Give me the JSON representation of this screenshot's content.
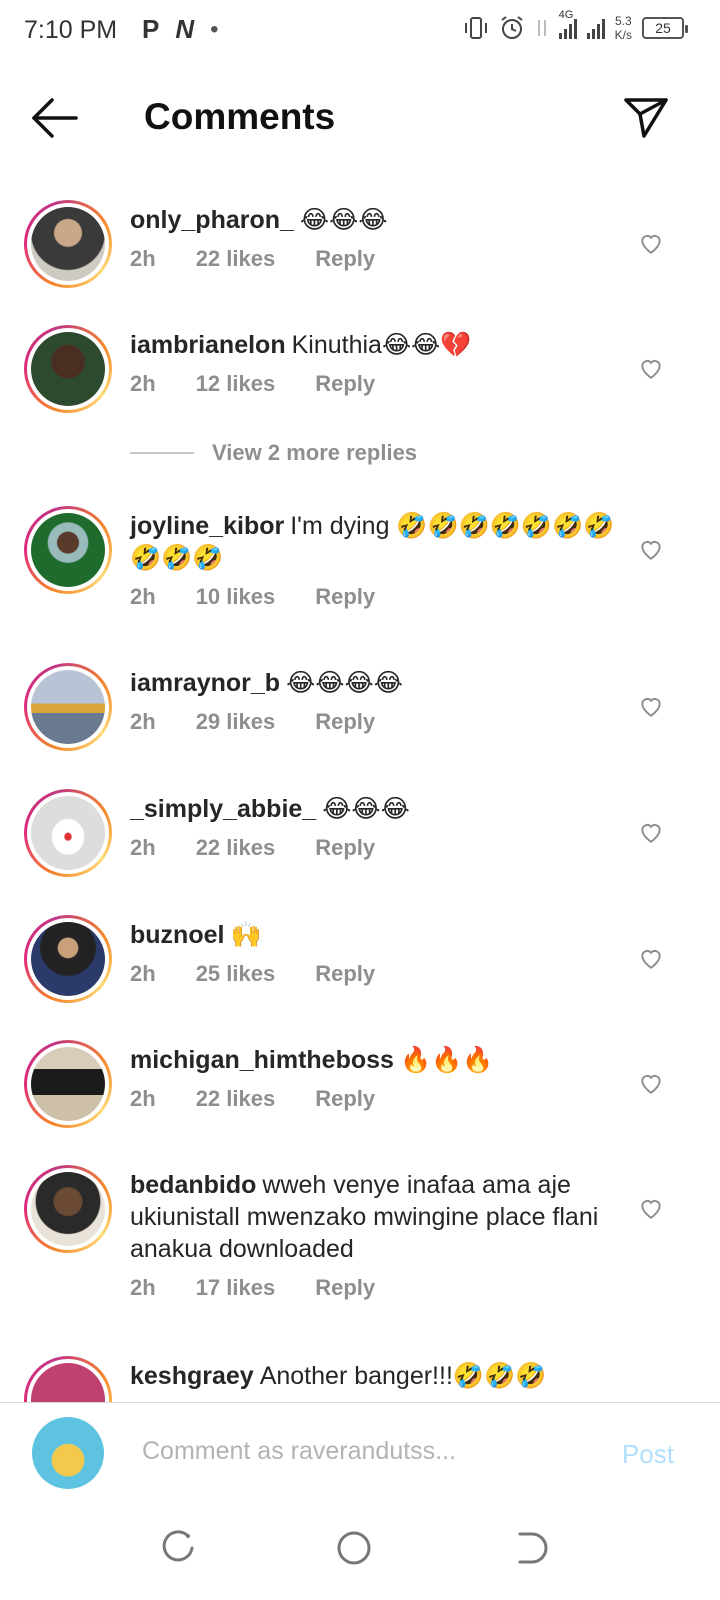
{
  "status_bar": {
    "time": "7:10 PM",
    "left_icons": [
      "P",
      "N",
      "•"
    ],
    "network": "4G",
    "speed_value": "5.3",
    "speed_unit": "K/s",
    "battery": "25"
  },
  "header": {
    "title": "Comments",
    "back_icon": "arrow-left-icon",
    "share_icon": "paper-plane-icon"
  },
  "comments": [
    {
      "username": "only_pharon_",
      "text": "😂😂😂",
      "time": "2h",
      "likes": "22 likes",
      "reply": "Reply",
      "avatar_color": "#8a7a6a"
    },
    {
      "username": "iambrianelon",
      "text": "Kinuthia😂😂💔",
      "time": "2h",
      "likes": "12 likes",
      "reply": "Reply",
      "avatar_color": "#3a5a3a"
    },
    {
      "username": "joyline_kibor",
      "text": "I'm dying 🤣🤣🤣🤣🤣🤣🤣🤣🤣🤣",
      "time": "2h",
      "likes": "10 likes",
      "reply": "Reply",
      "avatar_color": "#1f6b2e"
    },
    {
      "username": "iamraynor_b",
      "text": "😂😂😂😂",
      "time": "2h",
      "likes": "29 likes",
      "reply": "Reply",
      "avatar_color": "#9aa6b8"
    },
    {
      "username": "_simply_abbie_",
      "text": "😂😂😂",
      "time": "2h",
      "likes": "22 likes",
      "reply": "Reply",
      "avatar_color": "#e6e6e6"
    },
    {
      "username": "buznoel",
      "text": "🙌",
      "time": "2h",
      "likes": "25 likes",
      "reply": "Reply",
      "avatar_color": "#2b2b4a"
    },
    {
      "username": "michigan_himtheboss",
      "text": "🔥🔥🔥",
      "time": "2h",
      "likes": "22 likes",
      "reply": "Reply",
      "avatar_color": "#b8a892"
    },
    {
      "username": "bedanbido",
      "text": "wweh venye inafaa ama aje ukiunistall mwenzako mwingine place flani anakua downloaded",
      "time": "2h",
      "likes": "17 likes",
      "reply": "Reply",
      "avatar_color": "#6b5a4a"
    },
    {
      "username": "keshgraey",
      "text": "Another banger!!!🤣🤣🤣",
      "time": "",
      "likes": "",
      "reply": "",
      "avatar_color": "#c04070"
    }
  ],
  "view_replies": {
    "label": "View 2 more replies"
  },
  "compose": {
    "placeholder": "Comment as raverandutss...",
    "post_label": "Post"
  },
  "colors": {
    "post_disabled": "#b2dffc",
    "meta_gray": "#8e8e8e"
  }
}
